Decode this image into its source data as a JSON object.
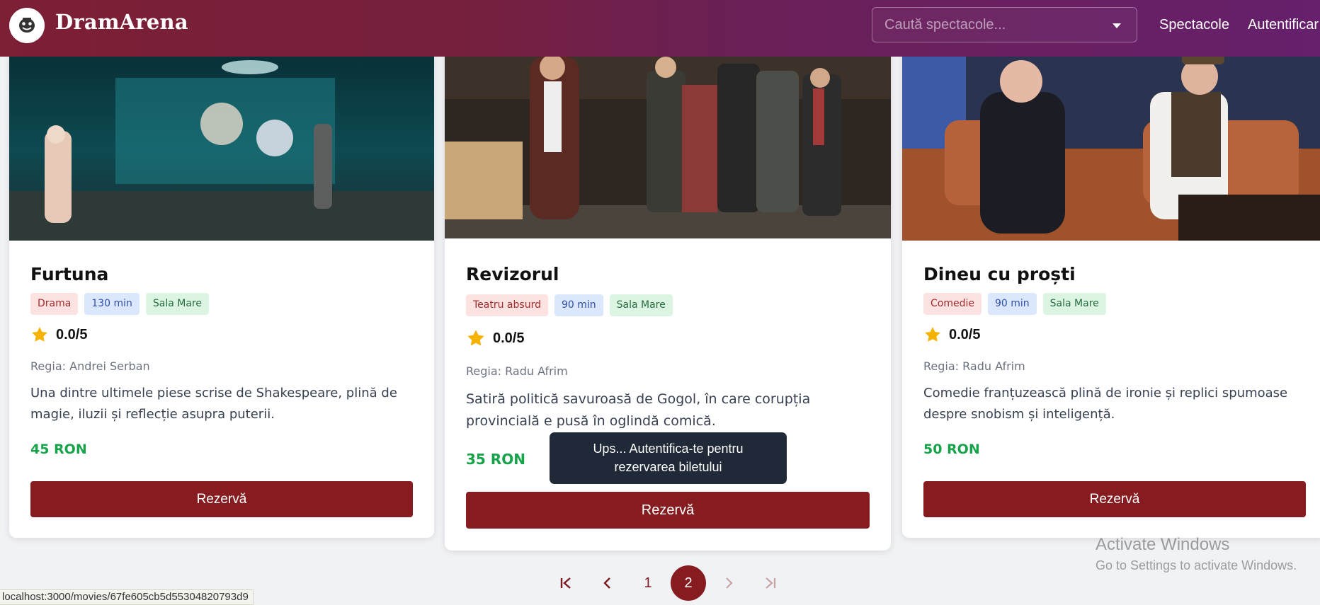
{
  "app": {
    "brand": "DramArena",
    "logo_icon": "theater-mask-icon"
  },
  "header": {
    "search_placeholder": "Caută spectacole...",
    "nav": {
      "shows": "Spectacole",
      "login": "Autentificar"
    }
  },
  "cards": [
    {
      "title": "Furtuna",
      "genre": "Drama",
      "duration": "130 min",
      "hall": "Sala Mare",
      "rating": "0.0/5",
      "director": "Regia: Andrei Serban",
      "description": "Una dintre ultimele piese scrise de Shakespeare, plină de magie, iluzii și reflecție asupra puterii.",
      "price": "45 RON",
      "button": "Rezervă"
    },
    {
      "title": "Revizorul",
      "genre": "Teatru absurd",
      "duration": "90 min",
      "hall": "Sala Mare",
      "rating": "0.0/5",
      "director": "Regia: Radu Afrim",
      "description": "Satiră politică savuroasă de Gogol, în care corupția provincială e pusă în oglindă comică.",
      "price": "35 RON",
      "button": "Rezervă"
    },
    {
      "title": "Dineu cu proști",
      "genre": "Comedie",
      "duration": "90 min",
      "hall": "Sala Mare",
      "rating": "0.0/5",
      "director": "Regia: Radu Afrim",
      "description": "Comedie franțuzească plină de ironie și replici spumoase despre snobism și inteligență.",
      "price": "50 RON",
      "button": "Rezervă"
    }
  ],
  "tooltip": {
    "line1": "Ups... Autentifica-te pentru",
    "line2": "rezervarea biletului"
  },
  "pagination": {
    "pages": [
      "1",
      "2"
    ],
    "current_page": "2",
    "first_icon": "first-page-icon",
    "prev_icon": "chevron-left-icon",
    "next_icon": "chevron-right-icon",
    "last_icon": "last-page-icon"
  },
  "windows_watermark": {
    "title": "Activate Windows",
    "subtitle": "Go to Settings to activate Windows."
  },
  "status_bar": {
    "url": "localhost:3000/movies/67fe605cb5d55304820793d9"
  },
  "colors": {
    "header_start": "#7d1f35",
    "header_end": "#66206c",
    "primary_button": "#861c1f",
    "price_green": "#16a34a",
    "star": "#f5b301",
    "tooltip_bg": "#1f2937"
  }
}
